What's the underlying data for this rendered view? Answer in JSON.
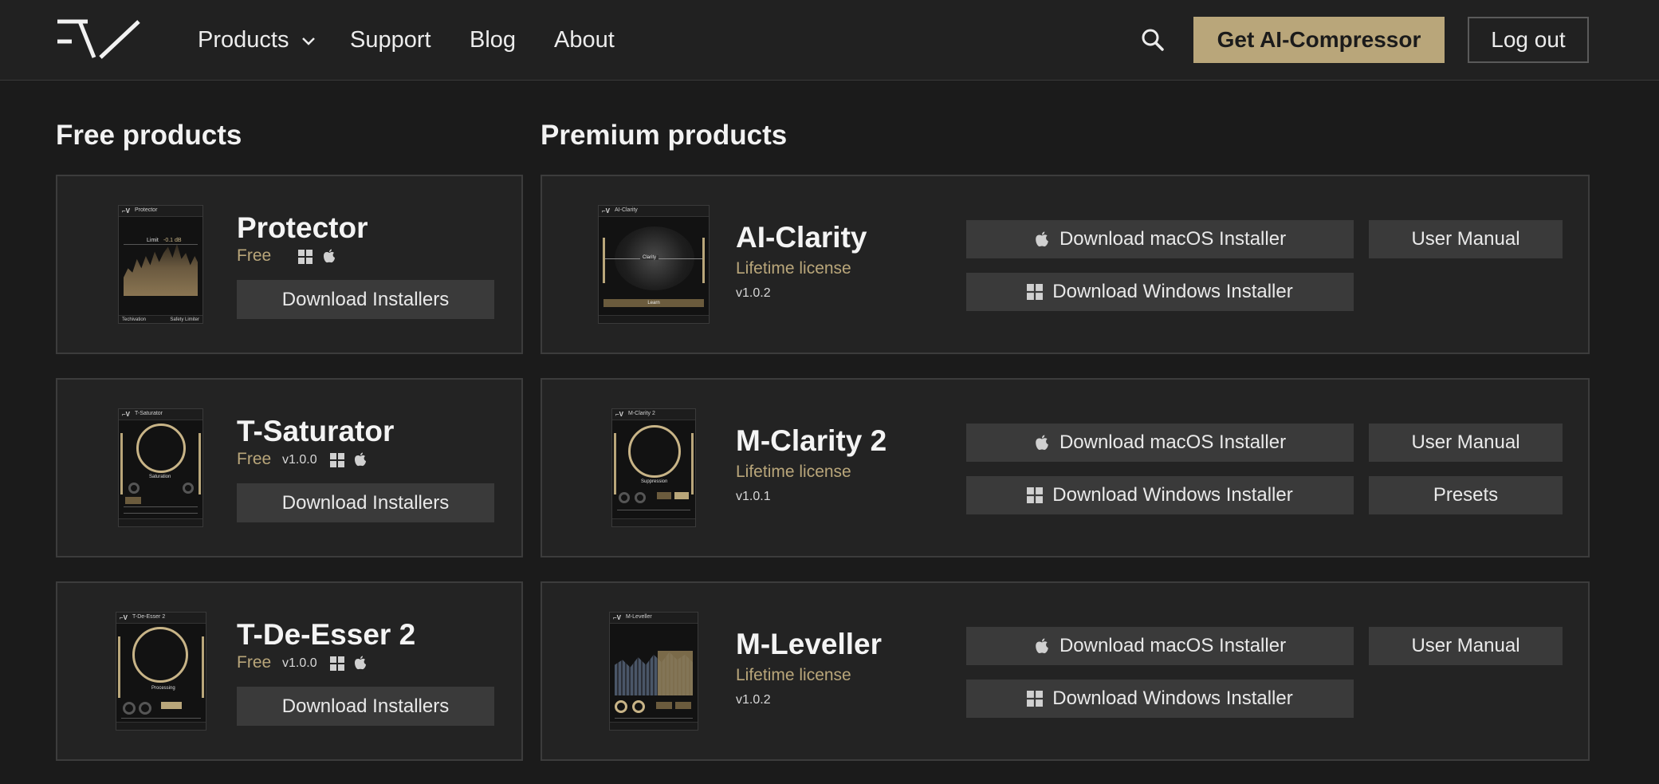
{
  "header": {
    "nav": [
      "Products",
      "Support",
      "Blog",
      "About"
    ],
    "cta_label": "Get AI-Compressor",
    "logout_label": "Log out",
    "icons": {
      "logo": "tv-logo",
      "products": "chevron-down-icon",
      "search": "search-icon"
    }
  },
  "sections": {
    "free_title": "Free products",
    "premium_title": "Premium products"
  },
  "free_products": [
    {
      "name": "Protector",
      "price": "Free",
      "version": "",
      "platforms": [
        "windows-icon",
        "apple-icon"
      ],
      "button": "Download Installers"
    },
    {
      "name": "T-Saturator",
      "price": "Free",
      "version": "v1.0.0",
      "platforms": [
        "windows-icon",
        "apple-icon"
      ],
      "button": "Download Installers"
    },
    {
      "name": "T-De-Esser 2",
      "price": "Free",
      "version": "v1.0.0",
      "platforms": [
        "windows-icon",
        "apple-icon"
      ],
      "button": "Download Installers"
    }
  ],
  "premium_products": [
    {
      "name": "AI-Clarity",
      "license": "Lifetime license",
      "version": "v1.0.2",
      "mac_button": "Download macOS Installer",
      "win_button": "Download Windows Installer",
      "aux_buttons": [
        "User Manual"
      ]
    },
    {
      "name": "M-Clarity 2",
      "license": "Lifetime license",
      "version": "v1.0.1",
      "mac_button": "Download macOS Installer",
      "win_button": "Download Windows Installer",
      "aux_buttons": [
        "User Manual",
        "Presets"
      ]
    },
    {
      "name": "M-Leveller",
      "license": "Lifetime license",
      "version": "v1.0.2",
      "mac_button": "Download macOS Installer",
      "win_button": "Download Windows Installer",
      "aux_buttons": [
        "User Manual"
      ]
    }
  ],
  "thumbnails": {
    "protector": {
      "title": "Protector",
      "row1": "Limit",
      "row2": "-0.1 dB",
      "foot_left": "Techivation",
      "foot_right": "Safety Limiter"
    },
    "t_saturator": {
      "title": "T-Saturator",
      "knob": "Saturation"
    },
    "t_de_esser": {
      "title": "T-De-Esser 2",
      "knob": "Processing"
    },
    "ai_clarity": {
      "title": "AI-Clarity",
      "center": "Clarity",
      "button": "Learn"
    },
    "m_clarity": {
      "title": "M-Clarity 2",
      "knob": "Suppression"
    },
    "m_leveller": {
      "title": "M-Leveller"
    }
  },
  "colors": {
    "accent": "#b9a67a",
    "background": "#1b1b1b",
    "card": "#232323",
    "button": "#3a3a3a"
  }
}
